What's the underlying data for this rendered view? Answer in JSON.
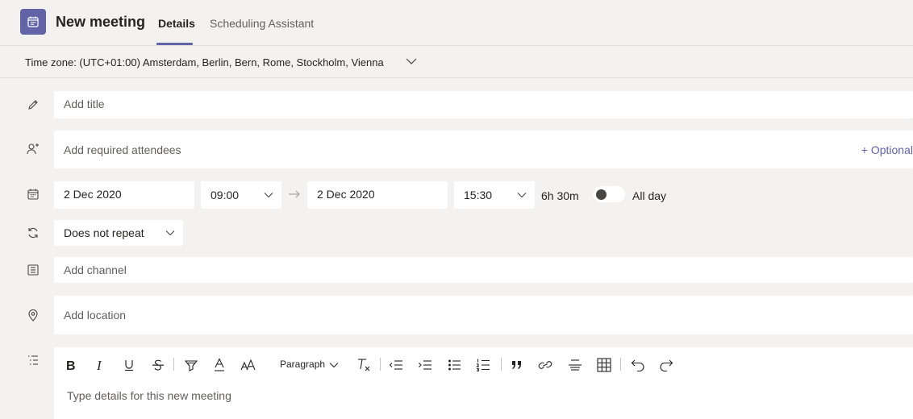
{
  "header": {
    "title": "New meeting",
    "tabs": [
      {
        "label": "Details",
        "active": true
      },
      {
        "label": "Scheduling Assistant",
        "active": false
      }
    ],
    "accent_color": "#6264a7"
  },
  "timezone": {
    "label": "Time zone: (UTC+01:00) Amsterdam, Berlin, Bern, Rome, Stockholm, Vienna"
  },
  "form": {
    "title_placeholder": "Add title",
    "attendees_placeholder": "Add required attendees",
    "optional_label": "+ Optional",
    "start_date": "2 Dec 2020",
    "start_time": "09:00",
    "end_date": "2 Dec 2020",
    "end_time": "15:30",
    "duration": "6h 30m",
    "all_day_label": "All day",
    "all_day_on": false,
    "repeat": "Does not repeat",
    "channel_placeholder": "Add channel",
    "location_placeholder": "Add location"
  },
  "editor": {
    "paragraph_label": "Paragraph",
    "placeholder": "Type details for this new meeting",
    "toolbar": [
      "bold-icon",
      "italic-icon",
      "underline-icon",
      "strikethrough-icon",
      "highlight-icon",
      "font-color-icon",
      "font-size-icon",
      "paragraph-style",
      "clear-format-icon",
      "decrease-indent-icon",
      "increase-indent-icon",
      "bullet-list-icon",
      "numbered-list-icon",
      "quote-icon",
      "link-icon",
      "horizontal-rule-icon",
      "table-icon",
      "undo-icon",
      "redo-icon"
    ]
  }
}
